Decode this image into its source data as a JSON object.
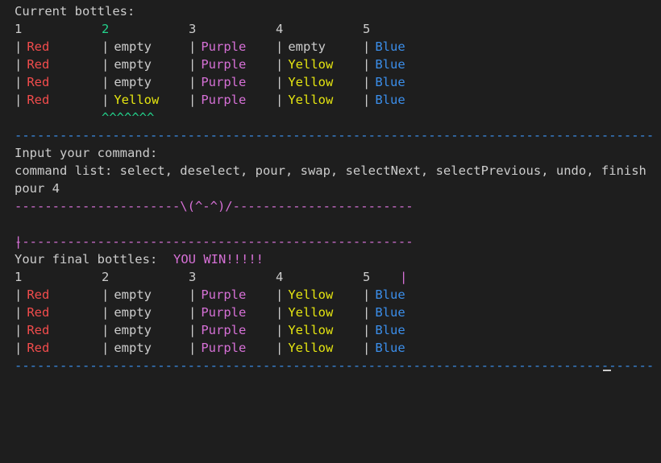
{
  "terminal": {
    "current_header": "Current bottles:",
    "final_header": "Your final bottles:",
    "input_prompt": "Input your command:",
    "command_list": "command list: select, deselect, pour, swap, selectNext, selectPrevious, undo, finish",
    "typed_command": "pour 4",
    "separator": "-------------------------------------------------------------------------------------",
    "short_separator": "-------------------------------------------------------------------------------",
    "win_top": "----------------------\\(^-^)/------------------------",
    "win_text": "YOU WIN!!!!!",
    "win_bottom": "-----------------------------------------------------",
    "selection_marker": "^^^^^^^"
  },
  "columns": [
    "1",
    "2",
    "3",
    "4",
    "5"
  ],
  "current_bottles": [
    [
      "Red",
      "empty",
      "Purple",
      "empty",
      "Blue"
    ],
    [
      "Red",
      "empty",
      "Purple",
      "Yellow",
      "Blue"
    ],
    [
      "Red",
      "empty",
      "Purple",
      "Yellow",
      "Blue"
    ],
    [
      "Red",
      "Yellow",
      "Purple",
      "Yellow",
      "Blue"
    ]
  ],
  "final_bottles": [
    [
      "Red",
      "empty",
      "Purple",
      "Yellow",
      "Blue"
    ],
    [
      "Red",
      "empty",
      "Purple",
      "Yellow",
      "Blue"
    ],
    [
      "Red",
      "empty",
      "Purple",
      "Yellow",
      "Blue"
    ],
    [
      "Red",
      "empty",
      "Purple",
      "Yellow",
      "Blue"
    ]
  ],
  "colors": {
    "background": "#1e1e1e",
    "text": "#cccccc",
    "red": "#f14c4c",
    "purple": "#d670d6",
    "yellow": "#e5e510",
    "blue": "#3b8eea",
    "green": "#23d18b"
  }
}
